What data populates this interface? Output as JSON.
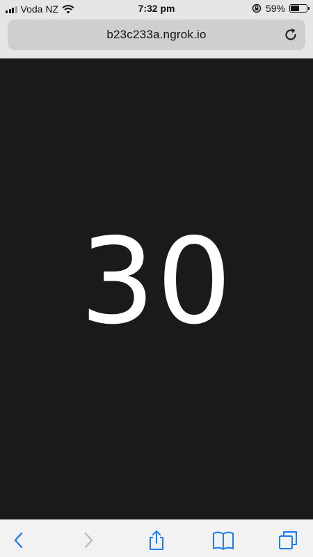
{
  "status_bar": {
    "carrier": "Voda NZ",
    "time": "7:32 pm",
    "battery_percent_label": "59%",
    "battery_level": 0.59
  },
  "browser": {
    "url": "b23c233a.ngrok.io",
    "icons": {
      "reload": "reload-icon",
      "back": "chevron-left-icon",
      "forward": "chevron-right-icon",
      "share": "share-icon",
      "bookmarks": "book-icon",
      "tabs": "tabs-icon"
    },
    "accent_color": "#1a7cf5"
  },
  "page": {
    "counter": "30",
    "background_color": "#1a1a1a"
  }
}
